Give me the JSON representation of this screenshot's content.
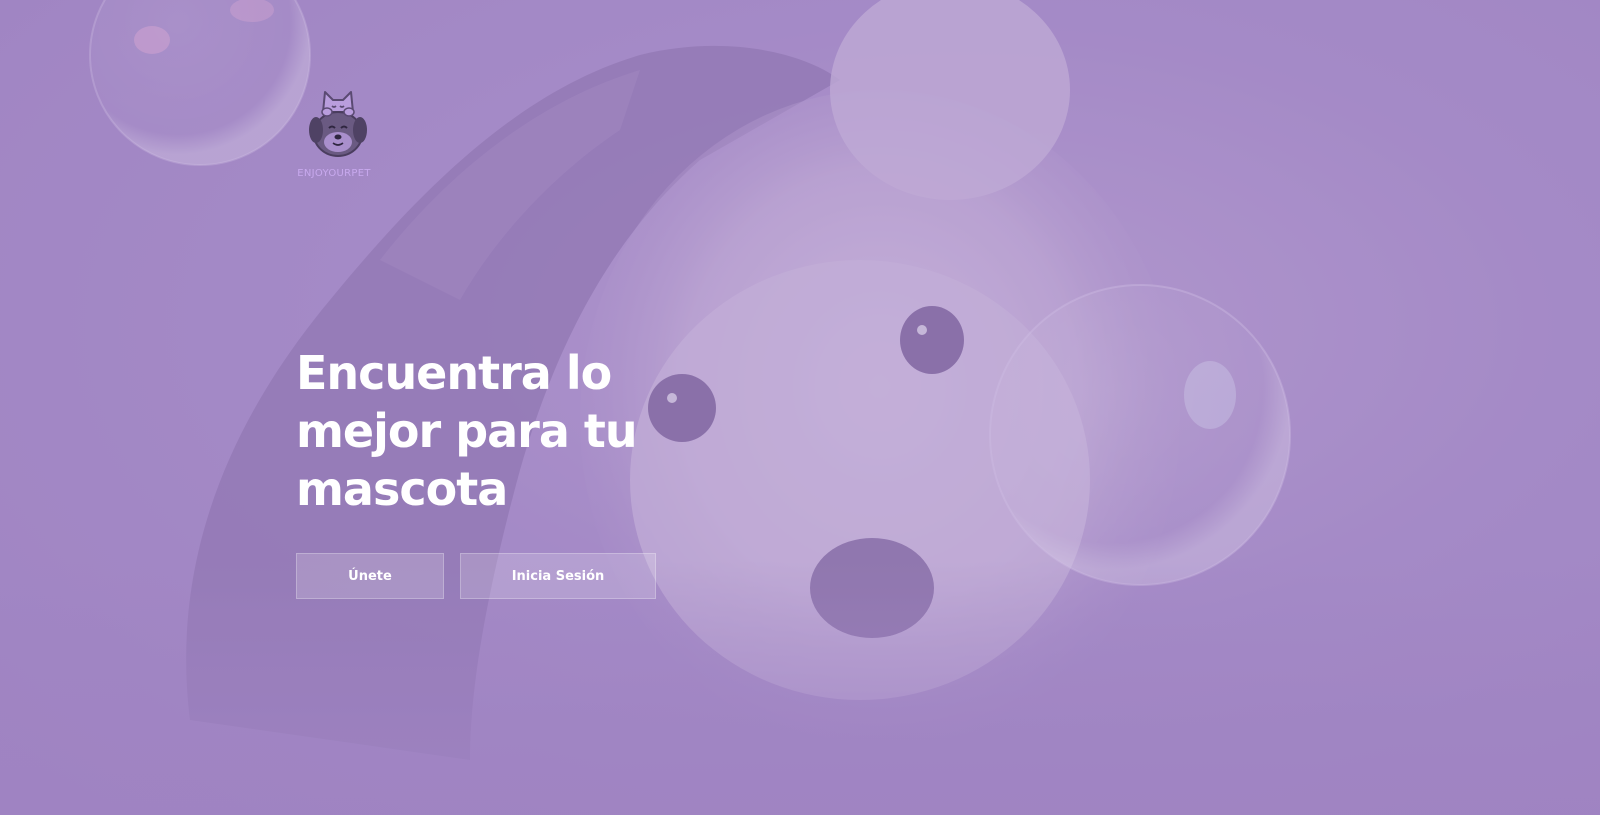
{
  "brand": {
    "name": "ENJOYOURPET",
    "logo_icon": "cat-dog-logo-icon"
  },
  "hero": {
    "headline": "Encuentra lo mejor para tu mascota",
    "background_image": "white-dog-in-towel-with-bubbles"
  },
  "actions": {
    "join_label": "Únete",
    "login_label": "Inicia Sesión"
  },
  "colors": {
    "overlay": "#a58cc6",
    "logo_text": "#c8a9ee",
    "text": "#ffffff"
  }
}
